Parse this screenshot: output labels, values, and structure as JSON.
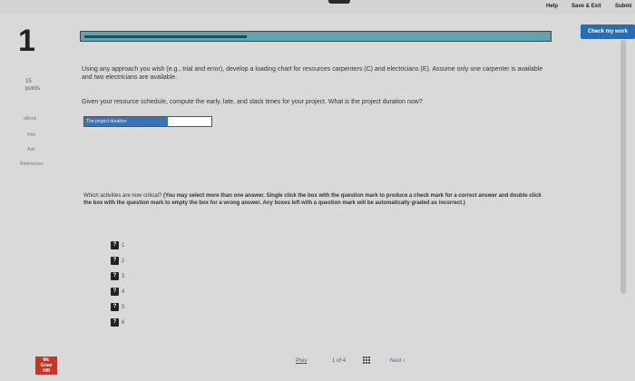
{
  "header": {
    "help": "Help",
    "save_exit": "Save & Exit",
    "submit": "Submi",
    "check_work": "Check my work"
  },
  "question": {
    "number": "1",
    "progress_fraction": 0.35,
    "points_value": "15",
    "points_label": "points"
  },
  "tools": {
    "ebook": "eBook",
    "hint": "Hint",
    "ask": "Ask",
    "references": "References"
  },
  "content": {
    "prompt": "Using any approach you wish (e.g., trial and error), develop a loading chart for resources carpenters (C) and electricians (E). Assume only one carpenter is available and two electricians are available.",
    "given": "Given your resource schedule, compute the early, late, and slack times for your project. What is the project duration now?",
    "answer_label": "The project duration",
    "answer_value": "",
    "critical_question": "Which activities are now critical?",
    "critical_instructions": "(You may select more than one answer. Single click the box with the question mark to produce a check mark for a correct answer and double click the box with the question mark to empty the box for a wrong answer. Any boxes left with a question mark will be automatically graded as incorrect.)"
  },
  "activities": [
    {
      "box": "?",
      "label": "1"
    },
    {
      "box": "?",
      "label": "2"
    },
    {
      "box": "?",
      "label": "3"
    },
    {
      "box": "?",
      "label": "4"
    },
    {
      "box": "?",
      "label": "5"
    },
    {
      "box": "?",
      "label": "6"
    }
  ],
  "footer": {
    "prev": "Prev",
    "page_current": "1",
    "page_of": "of",
    "page_total": "4",
    "next": "Next",
    "next_arrow": "›",
    "logo_lines": [
      "Mc",
      "Graw",
      "Hill"
    ]
  }
}
